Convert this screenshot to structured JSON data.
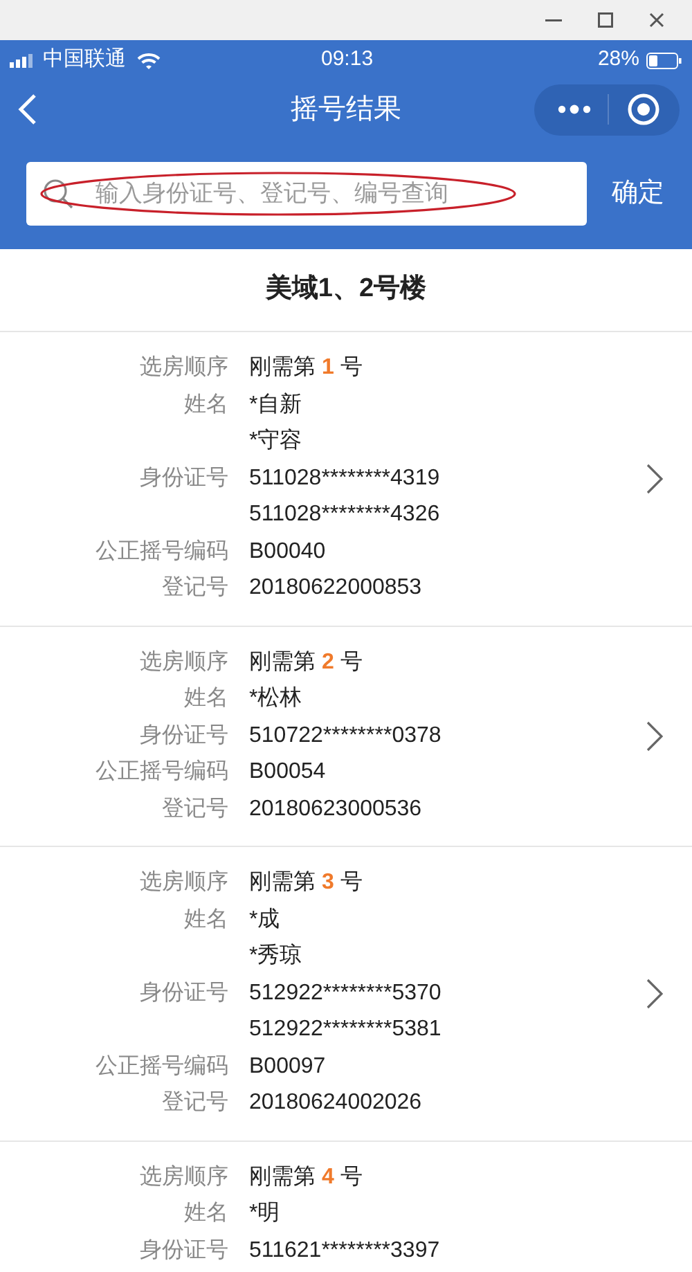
{
  "status_bar": {
    "carrier": "中国联通",
    "time": "09:13",
    "battery": "28%"
  },
  "nav": {
    "title": "摇号结果"
  },
  "search": {
    "placeholder": "输入身份证号、登记号、编号查询",
    "button": "确定"
  },
  "heading": "美域1、2号楼",
  "cards": [
    {
      "arrow": true,
      "fields": [
        {
          "label": "选房顺序",
          "kind": "order",
          "values": [
            "刚需第 **1** 号"
          ]
        },
        {
          "label": "姓名",
          "values": [
            "*自新",
            "*守容"
          ]
        },
        {
          "label": "身份证号",
          "values": [
            "511028********4319",
            "511028********4326"
          ]
        },
        {
          "label": "公正摇号编码",
          "values": [
            "B00040"
          ]
        },
        {
          "label": "登记号",
          "values": [
            "20180622000853"
          ]
        }
      ]
    },
    {
      "arrow": true,
      "fields": [
        {
          "label": "选房顺序",
          "kind": "order",
          "values": [
            "刚需第 **2** 号"
          ]
        },
        {
          "label": "姓名",
          "values": [
            "*松林"
          ]
        },
        {
          "label": "身份证号",
          "values": [
            "510722********0378"
          ]
        },
        {
          "label": "公正摇号编码",
          "values": [
            "B00054"
          ]
        },
        {
          "label": "登记号",
          "values": [
            "20180623000536"
          ]
        }
      ]
    },
    {
      "arrow": true,
      "fields": [
        {
          "label": "选房顺序",
          "kind": "order",
          "values": [
            "刚需第 **3** 号"
          ]
        },
        {
          "label": "姓名",
          "values": [
            "*成",
            "*秀琼"
          ]
        },
        {
          "label": "身份证号",
          "values": [
            "512922********5370",
            "512922********5381"
          ]
        },
        {
          "label": "公正摇号编码",
          "values": [
            "B00097"
          ]
        },
        {
          "label": "登记号",
          "values": [
            "20180624002026"
          ]
        }
      ]
    },
    {
      "arrow": false,
      "fields": [
        {
          "label": "选房顺序",
          "kind": "order",
          "values": [
            "刚需第 **4** 号"
          ]
        },
        {
          "label": "姓名",
          "values": [
            "*明"
          ]
        },
        {
          "label": "身份证号",
          "values": [
            "511621********3397"
          ]
        }
      ]
    }
  ]
}
